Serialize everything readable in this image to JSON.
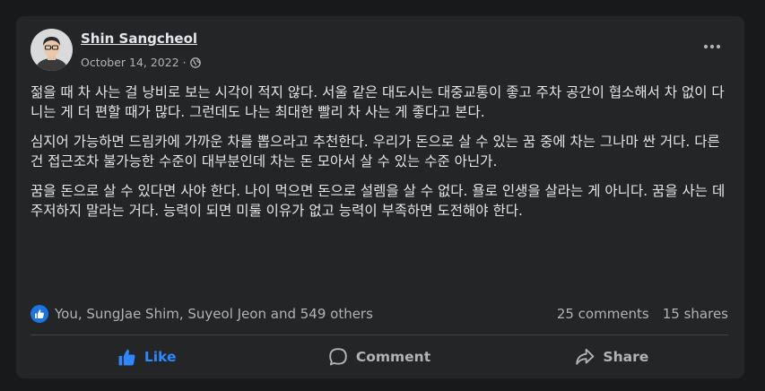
{
  "post": {
    "author": "Shin Sangcheol",
    "date": "October 14, 2022",
    "separator": "·",
    "audience_icon": "globe-icon",
    "paragraphs": [
      "젊을 때 차 사는 걸 낭비로 보는 시각이 적지 않다. 서울 같은 대도시는 대중교통이 좋고 주차 공간이 협소해서 차 없이 다니는 게 더 편할 때가 많다. 그런데도 나는 최대한 빨리 차 사는 게 좋다고 본다.",
      "심지어 가능하면 드림카에 가까운 차를 뽑으라고 추천한다. 우리가 돈으로 살 수 있는 꿈 중에 차는 그나마 싼 거다. 다른 건 접근조차 불가능한 수준이 대부분인데 차는 돈 모아서 살 수 있는 수준 아닌가.",
      "꿈을 돈으로 살 수 있다면 사야 한다. 나이 먹으면 돈으로 설렘을 살 수 없다. 욜로 인생을 살라는 게 아니다. 꿈을 사는 데 주저하지 말라는 거다. 능력이 되면 미룰 이유가 없고 능력이 부족하면 도전해야 한다."
    ]
  },
  "stats": {
    "reactors": "You, SungJae Shim, Suyeol Jeon and 549 others",
    "comments": "25 comments",
    "shares": "15 shares"
  },
  "actions": {
    "like": "Like",
    "comment": "Comment",
    "share": "Share"
  },
  "colors": {
    "background": "#18191a",
    "card": "#242526",
    "accent": "#2d88ff",
    "secondary_text": "#b0b3b8"
  }
}
